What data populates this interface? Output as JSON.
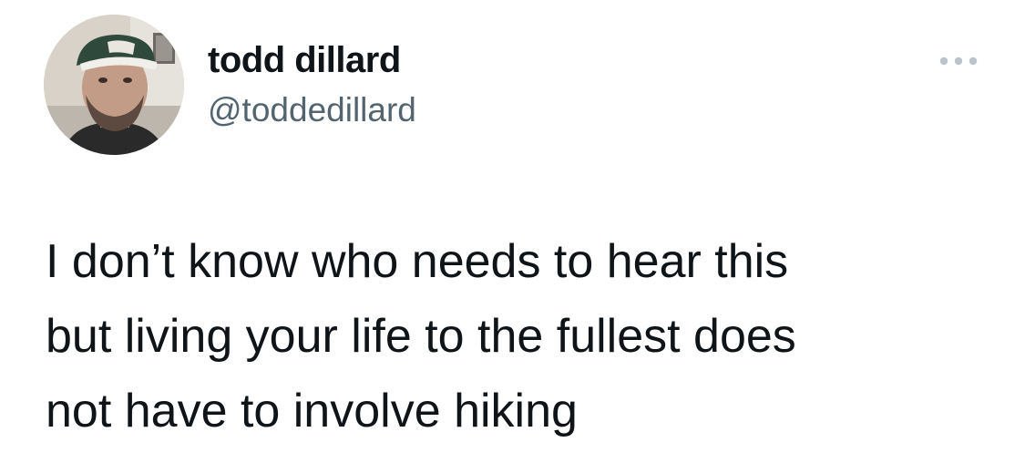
{
  "author": {
    "display_name": "todd dillard",
    "handle": "@toddedillard",
    "avatar_icon": "user-avatar"
  },
  "tweet": {
    "text": "I don’t know who needs to hear this\nbut living your life to the fullest does\nnot have to involve hiking"
  },
  "actions": {
    "more_icon": "more-horizontal-icon"
  },
  "colors": {
    "text_primary": "#0f1419",
    "text_secondary": "#536471",
    "icon_muted": "#b9c4cc"
  }
}
